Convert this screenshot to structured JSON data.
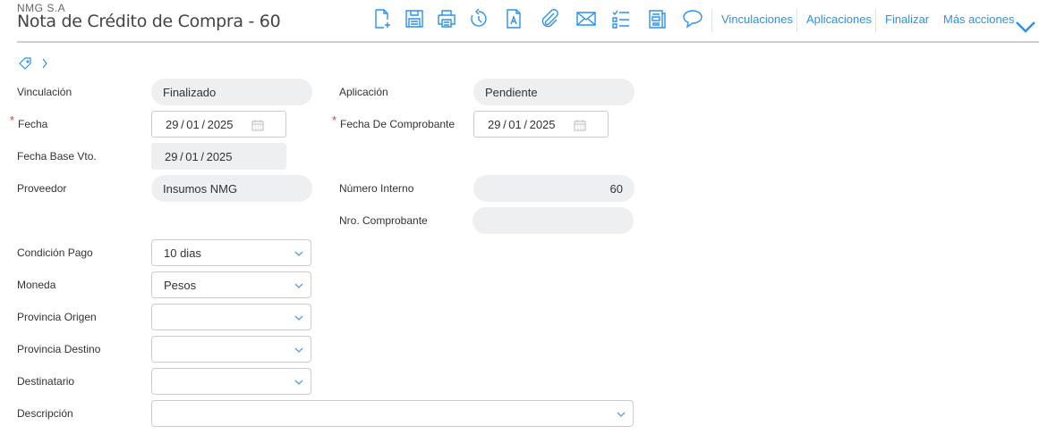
{
  "header": {
    "company": "NMG S.A",
    "title": "Nota de Crédito de Compra - 60"
  },
  "toolbar": {
    "icons": [
      "new-document-icon",
      "save-icon",
      "print-icon",
      "history-icon",
      "text-document-icon",
      "attachment-icon",
      "email-icon",
      "checklist-icon",
      "report-icon",
      "comment-icon"
    ],
    "links": {
      "vinculaciones": "Vinculaciones",
      "aplicaciones": "Aplicaciones",
      "finalizar": "Finalizar",
      "mas": "Más acciones"
    },
    "accent": "#2a92ec"
  },
  "form": {
    "vinculacion": {
      "label": "Vinculación",
      "value": "Finalizado"
    },
    "aplicacion": {
      "label": "Aplicación",
      "value": "Pendiente"
    },
    "fecha": {
      "label": "Fecha",
      "value": "29 / 01 / 2025"
    },
    "fecha_comprobante": {
      "label": "Fecha De Comprobante",
      "value": "29 / 01 / 2025"
    },
    "fecha_base": {
      "label": "Fecha Base Vto.",
      "value": "29 / 01 / 2025"
    },
    "proveedor": {
      "label": "Proveedor",
      "value": "Insumos NMG"
    },
    "numero_interno": {
      "label": "Número Interno",
      "value": "60"
    },
    "nro_comprobante": {
      "label": "Nro. Comprobante",
      "value": ""
    },
    "condicion_pago": {
      "label": "Condición Pago",
      "value": "10 dias"
    },
    "moneda": {
      "label": "Moneda",
      "value": "Pesos"
    },
    "provincia_origen": {
      "label": "Provincia Origen",
      "value": ""
    },
    "provincia_destino": {
      "label": "Provincia Destino",
      "value": ""
    },
    "destinatario": {
      "label": "Destinatario",
      "value": ""
    },
    "descripcion": {
      "label": "Descripción",
      "value": ""
    },
    "required_mark": "*"
  }
}
